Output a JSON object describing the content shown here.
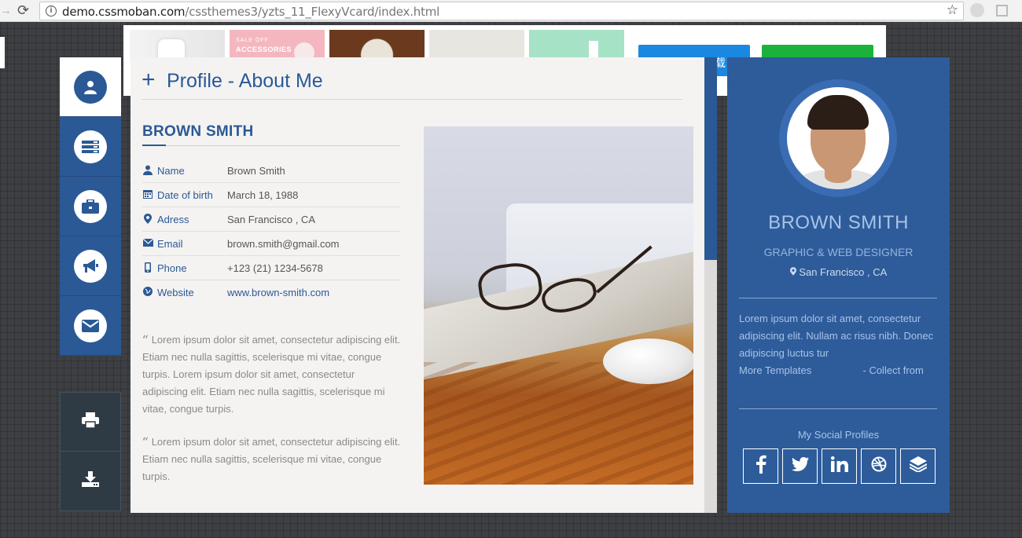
{
  "browser": {
    "url_host": "demo.cssmoban.com",
    "url_path": "/cssthemes3/yzts_11_FlexyVcard/index.html"
  },
  "ad": {
    "thumb2_line1": "SALE OFF",
    "thumb2_line2": "ACCESSORIES",
    "partial_text": "载"
  },
  "sidenav": {
    "items": [
      {
        "icon": "user-icon",
        "active": true
      },
      {
        "icon": "resume-icon",
        "active": false
      },
      {
        "icon": "briefcase-icon",
        "active": false
      },
      {
        "icon": "megaphone-icon",
        "active": false
      },
      {
        "icon": "envelope-icon",
        "active": false
      }
    ],
    "tools": [
      {
        "icon": "print-icon"
      },
      {
        "icon": "download-icon"
      }
    ]
  },
  "main": {
    "page_title": "Profile - About Me",
    "name_heading": "BROWN SMITH",
    "info": [
      {
        "icon": "user-icon",
        "label": "Name",
        "value": "Brown Smith",
        "link": false
      },
      {
        "icon": "calendar-icon",
        "label": "Date of birth",
        "value": "March 18, 1988",
        "link": false
      },
      {
        "icon": "map-marker-icon",
        "label": "Adress",
        "value": "San Francisco , CA",
        "link": false
      },
      {
        "icon": "envelope-icon",
        "label": "Email",
        "value": "brown.smith@gmail.com",
        "link": false
      },
      {
        "icon": "mobile-icon",
        "label": "Phone",
        "value": "+123 (21) 1234-5678",
        "link": false
      },
      {
        "icon": "globe-icon",
        "label": "Website",
        "value": "www.brown-smith.com",
        "link": true
      }
    ],
    "quote_mark": "“",
    "quote1": "Lorem ipsum dolor sit amet, consectetur adipiscing elit. Etiam nec nulla sagittis, scelerisque mi vitae, congue turpis. Lorem ipsum dolor sit amet, consectetur adipiscing elit. Etiam nec nulla sagittis, scelerisque mi vitae, congue turpis.",
    "quote2": "Lorem ipsum dolor sit amet, consectetur adipiscing elit. Etiam nec nulla sagittis, scelerisque mi vitae, congue turpis."
  },
  "profile": {
    "name": "BROWN SMITH",
    "role": "GRAPHIC & WEB DESIGNER",
    "location": "San Francisco , CA",
    "bio": "Lorem ipsum dolor sit amet, consectetur adipiscing elit. Nullam ac risus nibh. Donec adipiscing luctus tur",
    "more_templates": "More Templates",
    "collect_from": "- Collect from",
    "social_title": "My Social Profiles",
    "socials": [
      {
        "icon": "facebook-icon",
        "glyph": "f"
      },
      {
        "icon": "twitter-icon",
        "glyph": ""
      },
      {
        "icon": "linkedin-icon",
        "glyph": "in"
      },
      {
        "icon": "dribbble-icon",
        "glyph": ""
      },
      {
        "icon": "layers-icon",
        "glyph": ""
      }
    ]
  },
  "colors": {
    "accent": "#2b5996",
    "profile_bg": "#2e5c9a",
    "tool_bg": "#2e3a44"
  }
}
